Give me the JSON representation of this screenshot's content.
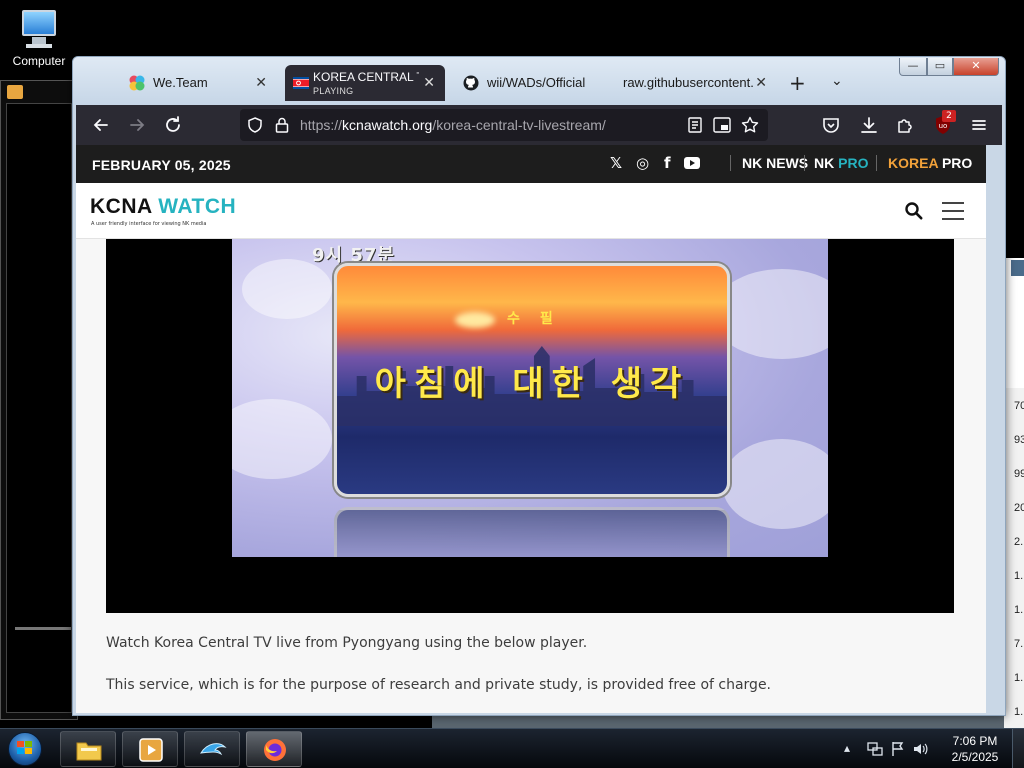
{
  "desktop": {
    "icon_label": "Computer",
    "right_window_cells": [
      "70",
      "93",
      "99",
      "20",
      "2.",
      "1.",
      "1.",
      "7.",
      "1.",
      "1."
    ]
  },
  "browser": {
    "tabs": [
      {
        "title": "We.Team",
        "close": "✕"
      },
      {
        "title": "KOREA CENTRAL TV",
        "subtitle": "PLAYING",
        "close": "✕"
      },
      {
        "title": "wii/WADs/Official C",
        "close": "✕"
      },
      {
        "title": "raw.githubusercontent.c",
        "close": "✕"
      }
    ],
    "new_tab": "+",
    "tab_list": "⌄",
    "window_buttons": {
      "min": "—",
      "max": "▭",
      "close": "✕"
    },
    "url": {
      "prefix": "https://",
      "host": "kcnawatch.org",
      "path": "/korea-central-tv-livestream/"
    },
    "extension_badge": "2"
  },
  "site": {
    "date": "FEBRUARY 05, 2025",
    "social": [
      "𝕏",
      "◎",
      "f"
    ],
    "brands": {
      "nknews": "NK NEWS",
      "nkpro_nk": "NK",
      "nkpro_pro": "PRO",
      "korea": "KOREA",
      "korea_pro": "PRO"
    },
    "logo_kcna": "KCNA",
    "logo_watch": "WATCH",
    "logo_tag": "A user friendly interface for viewing NK media",
    "video": {
      "clock": "9시 57분",
      "tag": "수필",
      "title": "아침에 대한 생각"
    },
    "intro_1": "Watch Korea Central TV live from Pyongyang using the below player.",
    "intro_2": "This service, which is for the purpose of research and private study, is provided free of charge."
  },
  "taskbar": {
    "time": "7:06 PM",
    "date": "2/5/2025",
    "tray": "▴"
  },
  "colors": {
    "accent_teal": "#26b3c0",
    "korea_pro_orange": "#f2a23a",
    "firefox_dark": "#2b2a33"
  }
}
